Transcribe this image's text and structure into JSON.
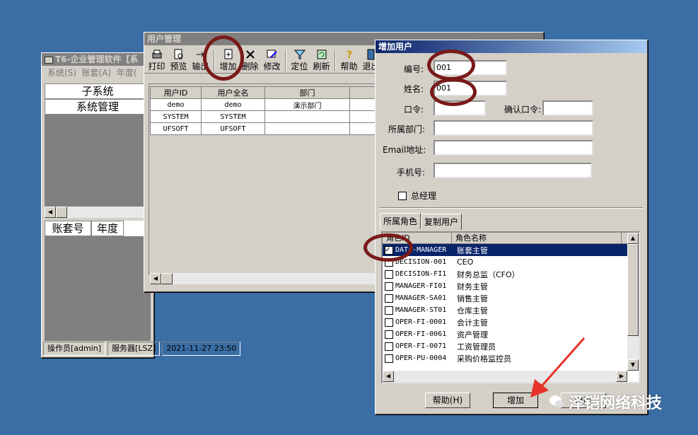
{
  "main_window": {
    "title": "T6-企业管理软件【系",
    "menu": [
      "系统(S)",
      "账套(A)",
      "年度("
    ],
    "grid_rows": [
      "子系统",
      "系统管理"
    ],
    "lower_headers": [
      "账套号",
      "年度"
    ],
    "status": [
      "操作员[admin]",
      "服务器[LSZ]",
      "2021-11-27 23:50"
    ]
  },
  "user_window": {
    "title": "用户管理",
    "toolbar": [
      {
        "label": "打印",
        "icon": "printer-icon"
      },
      {
        "label": "预览",
        "icon": "preview-icon"
      },
      {
        "label": "输出",
        "icon": "export-icon"
      },
      {
        "label": "增加",
        "icon": "add-icon"
      },
      {
        "label": "删除",
        "icon": "delete-icon"
      },
      {
        "label": "修改",
        "icon": "edit-icon"
      },
      {
        "label": "定位",
        "icon": "filter-icon"
      },
      {
        "label": "刷新",
        "icon": "refresh-icon"
      },
      {
        "label": "帮助",
        "icon": "help-icon"
      },
      {
        "label": "退出",
        "icon": "exit-icon"
      }
    ],
    "columns": [
      "用户ID",
      "用户全名",
      "部门"
    ],
    "rows": [
      [
        "demo",
        "demo",
        "演示部门"
      ],
      [
        "SYSTEM",
        "SYSTEM",
        ""
      ],
      [
        "UFSOFT",
        "UFSOFT",
        ""
      ]
    ]
  },
  "add_dialog": {
    "title": "增加用户",
    "labels": {
      "id": "编号:",
      "name": "姓名:",
      "password": "口令:",
      "confirm": "确认口令:",
      "dept": "所属部门:",
      "email": "Email地址:",
      "phone": "手机号:",
      "manager": "总经理"
    },
    "values": {
      "id": "001",
      "name": "001",
      "password": "",
      "confirm": "",
      "dept": "",
      "email": "",
      "phone": ""
    },
    "tabs": [
      "所属角色",
      "复制用户"
    ],
    "role_columns": [
      "角色ID",
      "角色名称"
    ],
    "roles": [
      {
        "id": "DATA-MANAGER",
        "name": "账套主管",
        "checked": true
      },
      {
        "id": "DECISION-001",
        "name": "CEO",
        "checked": false
      },
      {
        "id": "DECISION-FI1",
        "name": "财务总监（CFO）",
        "checked": false
      },
      {
        "id": "MANAGER-FI01",
        "name": "财务主管",
        "checked": false
      },
      {
        "id": "MANAGER-SA01",
        "name": "销售主管",
        "checked": false
      },
      {
        "id": "MANAGER-ST01",
        "name": "仓库主管",
        "checked": false
      },
      {
        "id": "OPER-FI-0001",
        "name": "会计主管",
        "checked": false
      },
      {
        "id": "OPER-FI-0061",
        "name": "资产管理",
        "checked": false
      },
      {
        "id": "OPER-FI-0071",
        "name": "工资管理员",
        "checked": false
      },
      {
        "id": "OPER-PU-0004",
        "name": "采购价格监控员",
        "checked": false
      }
    ],
    "buttons": {
      "help": "帮助(H)",
      "add": "增加",
      "exit": "退出"
    }
  },
  "watermark": "泽铠网络科技",
  "colors": {
    "desktop": "#3a6ea5",
    "annotation": "#7a1a1a",
    "arrow": "#e8322a",
    "selection": "#0a246a"
  }
}
